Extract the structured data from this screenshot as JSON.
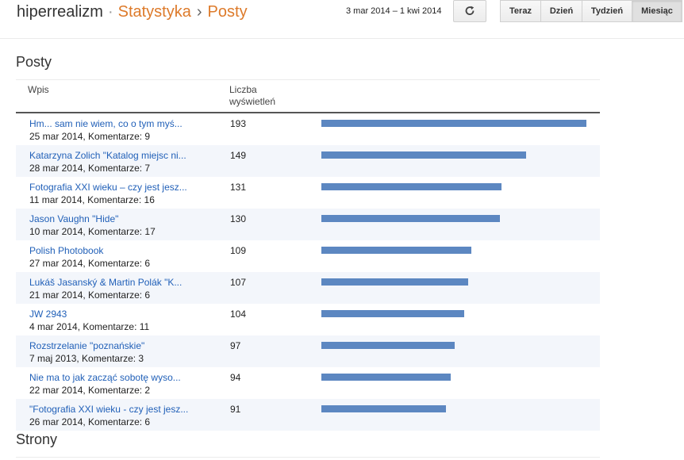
{
  "breadcrumb": {
    "blog": "hiperrealizm",
    "sep": "·",
    "section": "Statystyka",
    "arrow": "›",
    "page": "Posty"
  },
  "date_range": "3 mar 2014 – 1 kwi 2014",
  "refresh_icon": "refresh-icon",
  "periods": [
    {
      "label": "Teraz",
      "active": false
    },
    {
      "label": "Dzień",
      "active": false
    },
    {
      "label": "Tydzień",
      "active": false
    },
    {
      "label": "Miesiąc",
      "active": true
    }
  ],
  "posts_section": {
    "title": "Posty",
    "columns": {
      "post": "Wpis",
      "views_line1": "Liczba",
      "views_line2": "wyświetleń"
    },
    "rows": [
      {
        "title": "Hm... sam nie wiem, co o tym myś...",
        "meta": "25 mar 2014, Komentarze: 9",
        "views": 193
      },
      {
        "title": "Katarzyna Zolich \"Katalog miejsc ni...",
        "meta": "28 mar 2014, Komentarze: 7",
        "views": 149
      },
      {
        "title": "Fotografia XXI wieku – czy jest jesz...",
        "meta": "11 mar 2014, Komentarze: 16",
        "views": 131
      },
      {
        "title": "Jason Vaughn \"Hide\"",
        "meta": "10 mar 2014, Komentarze: 17",
        "views": 130
      },
      {
        "title": "Polish Photobook",
        "meta": "27 mar 2014, Komentarze: 6",
        "views": 109
      },
      {
        "title": "Lukáš Jasanský & Martin Polák \"K...",
        "meta": "21 mar 2014, Komentarze: 6",
        "views": 107
      },
      {
        "title": "JW 2943",
        "meta": "4 mar 2014, Komentarze: 11",
        "views": 104
      },
      {
        "title": "Rozstrzelanie \"poznańskie\"",
        "meta": "7 maj 2013, Komentarze: 3",
        "views": 97
      },
      {
        "title": "Nie ma to jak zacząć sobotę wyso...",
        "meta": "22 mar 2014, Komentarze: 2",
        "views": 94
      },
      {
        "title": "\"Fotografia XXI wieku - czy jest jesz...",
        "meta": "26 mar 2014, Komentarze: 6",
        "views": 91
      }
    ]
  },
  "pages_section": {
    "title": "Strony"
  },
  "colors": {
    "accent": "#dd7a2a",
    "link": "#2160b8",
    "bar": "#5c87c1",
    "row_alt": "#f3f6fb"
  }
}
